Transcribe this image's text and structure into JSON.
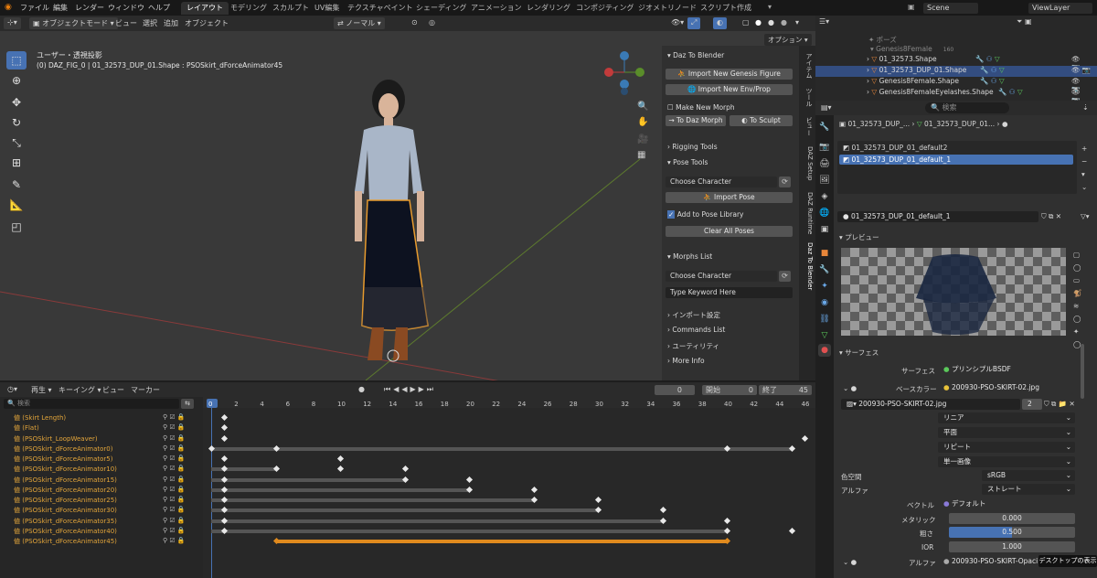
{
  "menu": {
    "items": [
      "ファイル",
      "編集",
      "レンダー",
      "ウィンドウ",
      "ヘルプ"
    ]
  },
  "workspaces": [
    "レイアウト",
    "モデリング",
    "スカルプト",
    "UV編集",
    "テクスチャペイント",
    "シェーディング",
    "アニメーション",
    "レンダリング",
    "コンポジティング",
    "ジオメトリノード",
    "スクリプト作成"
  ],
  "scene": {
    "scene_name": "Scene",
    "viewlayer": "ViewLayer"
  },
  "viewport_header": {
    "mode": "オブジェクトモード",
    "view": "ビュー",
    "select": "選択",
    "add": "追加",
    "object": "オブジェクト",
    "orientation": "ノーマル",
    "options": "オプション"
  },
  "viewport": {
    "view_name": "ユーザー・透視投影",
    "object_info": "(0) DAZ_FIG_0 | 01_32573_DUP_01.Shape : PSOSkirt_dForceAnimator45"
  },
  "npanel": {
    "daz_title": "Daz To Blender",
    "import_genesis": "Import New Genesis Figure",
    "import_env": "Import New Env/Prop",
    "make_morph": "Make New Morph",
    "to_daz_morph": "To Daz Morph",
    "to_sculpt": "To Sculpt",
    "rigging": "Rigging Tools",
    "pose_tools": "Pose Tools",
    "choose_char": "Choose Character",
    "import_pose": "Import Pose",
    "add_pose_lib": "Add to Pose Library",
    "clear_poses": "Clear All Poses",
    "morphs_list": "Morphs List",
    "choose_char2": "Choose Character",
    "type_keyword": "Type Keyword Here",
    "import_settings": "インポート設定",
    "commands_list": "Commands List",
    "utility": "ユーティリティ",
    "more_info": "More Info",
    "tabs": [
      "アイテム",
      "ツール",
      "ビュー",
      "DAZ Setup",
      "DAZ Runtime",
      "Daz To Blender"
    ]
  },
  "timeline_header": {
    "playback": "再生",
    "keying": "キーイング",
    "view": "ビュー",
    "marker": "マーカー",
    "current": "0",
    "start_label": "開始",
    "start": "0",
    "end_label": "終了",
    "end": "45",
    "search": "検索"
  },
  "frames": [
    "0",
    "2",
    "4",
    "6",
    "8",
    "10",
    "12",
    "14",
    "16",
    "18",
    "20",
    "22",
    "24",
    "26",
    "28",
    "30",
    "32",
    "34",
    "36",
    "38",
    "40",
    "42",
    "44",
    "46"
  ],
  "channels": [
    "値 (Skirt Length)",
    "値 (Flat)",
    "値 (PSOSkirt_LoopWeaver)",
    "値 (PSOSkirt_dForceAnimator0)",
    "値 (PSOSkirt_dForceAnimator5)",
    "値 (PSOSkirt_dForceAnimator10)",
    "値 (PSOSkirt_dForceAnimator15)",
    "値 (PSOSkirt_dForceAnimator20)",
    "値 (PSOSkirt_dForceAnimator25)",
    "値 (PSOSkirt_dForceAnimator30)",
    "値 (PSOSkirt_dForceAnimator35)",
    "値 (PSOSkirt_dForceAnimator40)",
    "値 (PSOSkirt_dForceAnimator45)"
  ],
  "keyframes": [
    [
      1
    ],
    [
      1
    ],
    [
      1,
      46
    ],
    [
      0,
      5,
      40,
      45
    ],
    [
      1,
      10
    ],
    [
      1,
      5,
      10,
      15
    ],
    [
      1,
      15,
      20
    ],
    [
      1,
      20,
      25
    ],
    [
      1,
      25,
      30
    ],
    [
      1,
      30,
      35
    ],
    [
      1,
      35,
      40
    ],
    [
      1,
      40,
      45
    ],
    [
      5,
      40
    ]
  ],
  "holds": [
    [],
    [],
    [],
    [
      0,
      45
    ],
    [],
    [
      0,
      5
    ],
    [
      0,
      15
    ],
    [
      0,
      20
    ],
    [
      0,
      25
    ],
    [
      0,
      30
    ],
    [
      0,
      35
    ],
    [
      0,
      40
    ],
    [
      5,
      40
    ]
  ],
  "outliner": {
    "search": "",
    "rows": [
      "ポーズ",
      "Genesis8Female",
      "01_32573.Shape",
      "01_32573_DUP_01.Shape",
      "Genesis8Female.Shape",
      "Genesis8FemaleEyelashes.Shape"
    ],
    "badge": "160"
  },
  "props": {
    "breadcrumb1": "01_32573_DUP_...",
    "breadcrumb2": "01_32573_DUP_01...",
    "search": "検索",
    "slots": [
      "01_32573_DUP_01_default2",
      "01_32573_DUP_01_default_1"
    ],
    "material": "01_32573_DUP_01_default_1",
    "preview": "プレビュー",
    "surface_section": "サーフェス",
    "surface_label": "サーフェス",
    "surface_value": "プリンシプルBSDF",
    "basecolor_label": "ベースカラー",
    "basecolor_value": "200930-PSO-SKIRT-02.jpg",
    "image_name": "200930-PSO-SKIRT-02.jpg",
    "image_users": "2",
    "interp": "リニア",
    "proj": "平面",
    "ext": "リピート",
    "source": "単一画像",
    "colorspace_label": "色空間",
    "colorspace": "sRGB",
    "alpha_label": "アルファ",
    "alpha": "ストレート",
    "vector_label": "ベクトル",
    "vector": "デフォルト",
    "metallic_label": "メタリック",
    "metallic": "0.000",
    "roughness_label": "粗さ",
    "roughness": "0.500",
    "ior_label": "IOR",
    "ior": "1.000",
    "alpha2_label": "アルファ",
    "alpha2": "200930-PSO-SKIRT-Opaci",
    "tooltip": "デスクトップの表示"
  },
  "colors": {
    "accent": "#4772b3",
    "keyframe_orange": "#e08a1e",
    "selection": "#e89b2e"
  }
}
